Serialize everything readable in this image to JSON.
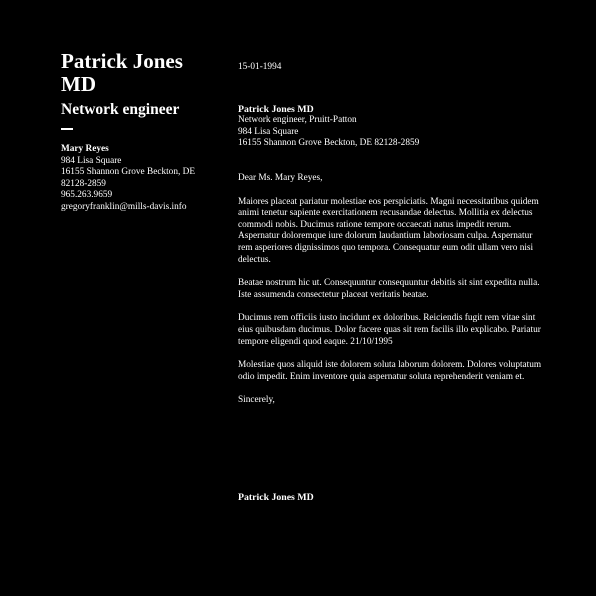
{
  "applicant": {
    "name": "Patrick Jones MD",
    "job_title": "Network engineer"
  },
  "recipient": {
    "name": "Mary Reyes",
    "street": "984 Lisa Square",
    "city_line": "16155 Shannon Grove Beckton, DE 82128-2859",
    "phone": "965.263.9659",
    "email": "gregoryfranklin@mills-davis.info"
  },
  "letter": {
    "date": "15-01-1994",
    "sender_name": "Patrick Jones MD",
    "sender_role_company": "Network engineer, Pruitt-Patton",
    "sender_street": "984 Lisa Square",
    "sender_city_line": "16155 Shannon Grove Beckton, DE 82128-2859",
    "salutation": "Dear Ms. Mary Reyes,",
    "paragraphs": [
      "Maiores placeat pariatur molestiae eos perspiciatis. Magni necessitatibus quidem animi tenetur sapiente exercitationem recusandae delectus. Mollitia ex delectus commodi nobis. Ducimus ratione tempore occaecati natus impedit rerum. Aspernatur doloremque iure dolorum laudantium laboriosam culpa. Aspernatur rem asperiores dignissimos quo tempora. Consequatur eum odit ullam vero nisi delectus.",
      "Beatae nostrum hic ut. Consequuntur consequuntur debitis sit sint expedita nulla. Iste assumenda consectetur placeat veritatis beatae.",
      "Ducimus rem officiis iusto incidunt ex doloribus. Reiciendis fugit rem vitae sint eius quibusdam ducimus. Dolor facere quas sit rem facilis illo explicabo. Pariatur tempore eligendi quod eaque. 21/10/1995",
      "Molestiae quos aliquid iste dolorem soluta laborum dolorem. Dolores voluptatum odio impedit. Enim inventore quia aspernatur soluta reprehenderit veniam et."
    ],
    "closing": "Sincerely,",
    "signature": "Patrick Jones MD"
  }
}
